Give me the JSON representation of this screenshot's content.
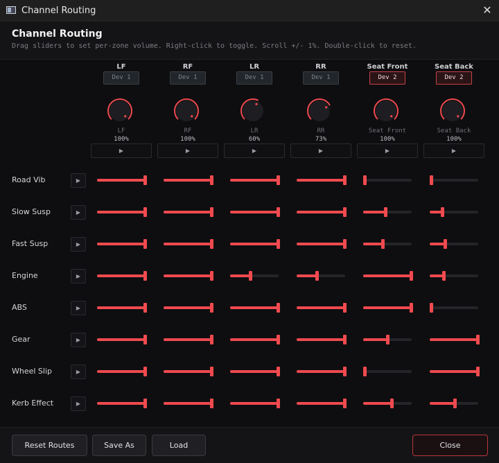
{
  "window": {
    "title": "Channel Routing"
  },
  "header": {
    "title": "Channel Routing",
    "hint": "Drag sliders to set per-zone volume.  Right-click to toggle.  Scroll +/- 1%.  Double-click to reset."
  },
  "accent_color": "#ef4a4f",
  "icons": {
    "play": "▶",
    "close": "✕"
  },
  "zones": [
    {
      "name": "LF",
      "device": "Dev 1",
      "device_active": false,
      "knob_label": "LF",
      "level_text": "100%",
      "level": 100
    },
    {
      "name": "RF",
      "device": "Dev 1",
      "device_active": false,
      "knob_label": "RF",
      "level_text": "100%",
      "level": 100
    },
    {
      "name": "LR",
      "device": "Dev 1",
      "device_active": false,
      "knob_label": "LR",
      "level_text": "60%",
      "level": 60
    },
    {
      "name": "RR",
      "device": "Dev 1",
      "device_active": false,
      "knob_label": "RR",
      "level_text": "73%",
      "level": 73
    },
    {
      "name": "Seat Front",
      "device": "Dev 2",
      "device_active": true,
      "knob_label": "Seat Front",
      "level_text": "100%",
      "level": 100
    },
    {
      "name": "Seat Back",
      "device": "Dev 2",
      "device_active": true,
      "knob_label": "Seat Back",
      "level_text": "100%",
      "level": 100
    }
  ],
  "channels": [
    {
      "name": "Road Vib",
      "values": [
        100,
        100,
        100,
        100,
        0,
        0
      ]
    },
    {
      "name": "Slow Susp",
      "values": [
        100,
        100,
        100,
        100,
        45,
        25
      ]
    },
    {
      "name": "Fast Susp",
      "values": [
        100,
        100,
        100,
        100,
        40,
        32
      ]
    },
    {
      "name": "Engine",
      "values": [
        100,
        100,
        42,
        42,
        100,
        28
      ]
    },
    {
      "name": "ABS",
      "values": [
        100,
        100,
        100,
        100,
        100,
        0
      ]
    },
    {
      "name": "Gear",
      "values": [
        100,
        100,
        100,
        100,
        50,
        100
      ]
    },
    {
      "name": "Wheel Slip",
      "values": [
        100,
        100,
        100,
        100,
        0,
        100
      ]
    },
    {
      "name": "Kerb Effect",
      "values": [
        100,
        100,
        100,
        100,
        58,
        52
      ]
    }
  ],
  "footer": {
    "reset_label": "Reset Routes",
    "save_as_label": "Save As",
    "load_label": "Load",
    "close_label": "Close"
  }
}
